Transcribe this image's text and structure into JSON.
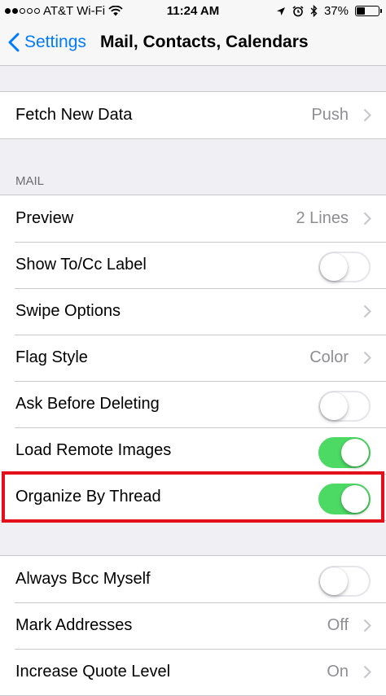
{
  "status_bar": {
    "carrier": "AT&T Wi-Fi",
    "time": "11:24 AM",
    "battery": "37%",
    "battery_level": 0.37,
    "signal_dots_filled": 2,
    "signal_dots_total": 5,
    "icons": [
      "wifi-icon",
      "location-icon",
      "alarm-icon",
      "bluetooth-icon",
      "battery-icon"
    ]
  },
  "nav": {
    "back_label": "Settings",
    "title": "Mail, Contacts, Calendars"
  },
  "fetch_group": {
    "rows": [
      {
        "label": "Fetch New Data",
        "value": "Push"
      }
    ]
  },
  "mail_section": {
    "header": "MAIL",
    "rows": [
      {
        "label": "Preview",
        "value": "2 Lines"
      },
      {
        "label": "Show To/Cc Label",
        "toggle": false
      },
      {
        "label": "Swipe Options"
      },
      {
        "label": "Flag Style",
        "value": "Color"
      },
      {
        "label": "Ask Before Deleting",
        "toggle": false
      },
      {
        "label": "Load Remote Images",
        "toggle": true
      },
      {
        "label": "Organize By Thread",
        "toggle": true
      }
    ]
  },
  "compose_group": {
    "rows": [
      {
        "label": "Always Bcc Myself",
        "toggle": false
      },
      {
        "label": "Mark Addresses",
        "value": "Off"
      },
      {
        "label": "Increase Quote Level",
        "value": "On"
      }
    ]
  },
  "colors": {
    "accent": "#007aff",
    "toggle_on": "#4cd964",
    "highlight": "#e3101b",
    "background": "#efeff4"
  }
}
